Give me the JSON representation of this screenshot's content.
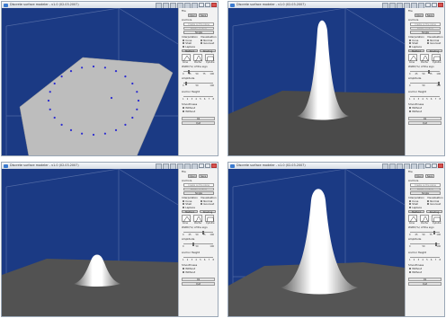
{
  "window_title": "Discrete surface modeler - v1.0 (02.03.2007)",
  "panel": {
    "file_label": "File",
    "open_label": "Open",
    "save_label": "Save",
    "anchors_label": "Anchors",
    "create_label": "Create on the plane",
    "delete_label": "Delete anchors",
    "single_label": "Single",
    "interpolation_label": "Interpolation",
    "visualisation_label": "Visualisation",
    "interp_options": [
      "Cone",
      "Shell",
      "Laplace"
    ],
    "visual_options": [
      "Normal",
      "Gouraud"
    ],
    "interp_selected": 1,
    "visual_selected": 1,
    "method_label": "Method",
    "shading_label": "Shading",
    "profile_labels": [
      "Cone",
      "Cloche",
      "Cylindre"
    ],
    "width_label": "Width(%) of the sign",
    "width_scale": [
      "0",
      "25",
      "50",
      "75",
      "100"
    ],
    "amplitude_label": "Amplitude",
    "amp_scale": [
      "0",
      "50",
      "100"
    ],
    "anchor_height_label": "Anchor Height",
    "height_scale": [
      "1",
      "2",
      "3",
      "4",
      "5",
      "6",
      "7",
      "8"
    ],
    "smoothness_label": "Smoothness",
    "smooth_options": [
      "Without",
      "Without"
    ],
    "ok_label": "Ok",
    "quit_label": "Quit"
  },
  "views": [
    {
      "scene": "plane-anchors",
      "width_value": 0.15,
      "amp_value": 0.05
    },
    {
      "scene": "peak-tall",
      "width_value": 0.6,
      "amp_value": 0.95
    },
    {
      "scene": "peak-small",
      "width_value": 0.65,
      "amp_value": 0.3
    },
    {
      "scene": "peak-wide",
      "width_value": 0.8,
      "amp_value": 0.85
    }
  ],
  "colors": {
    "viewport_bg": "#1b3a84",
    "plane": "#bdbdbd",
    "anchor_dot": "#2a2ad0",
    "grid_line": "#4f68a4",
    "selected_radio": "#1e5bd6"
  }
}
